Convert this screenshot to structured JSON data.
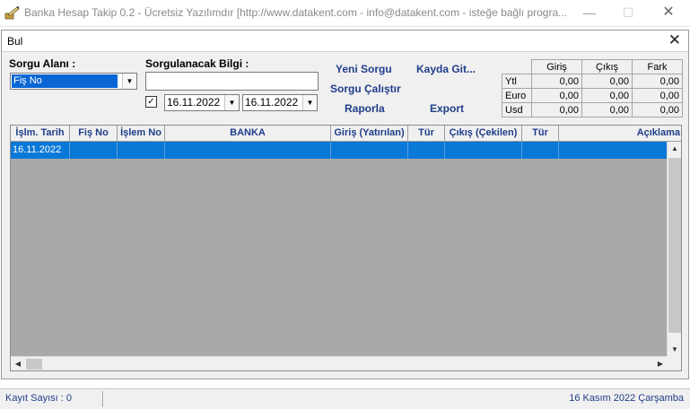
{
  "window": {
    "title": "Banka Hesap Takip 0.2 - Ücretsiz Yazılımdır [http://www.datakent.com - info@datakent.com - isteğe bağlı progra...",
    "minimize": "—",
    "maximize": "☐",
    "close": "✕"
  },
  "dialog": {
    "title": "Bul",
    "close": "✕"
  },
  "query": {
    "field_label": "Sorgu Alanı :",
    "field_value": "Fiş No",
    "info_label": "Sorgulanacak Bilgi :",
    "info_value": "",
    "date_check": "✓",
    "date_from": "16.11.2022",
    "date_to": "16.11.2022"
  },
  "actions": {
    "new_query": "Yeni Sorgu",
    "run_query": "Sorgu Çalıştır",
    "report": "Raporla",
    "goto_record": "Kayda Git...",
    "export": "Export"
  },
  "currency_table": {
    "headers": [
      "Giriş",
      "Çıkış",
      "Fark"
    ],
    "rows": [
      {
        "name": "Ytl",
        "values": [
          "0,00",
          "0,00",
          "0,00"
        ]
      },
      {
        "name": "Euro",
        "values": [
          "0,00",
          "0,00",
          "0,00"
        ]
      },
      {
        "name": "Usd",
        "values": [
          "0,00",
          "0,00",
          "0,00"
        ]
      }
    ]
  },
  "grid": {
    "columns": [
      "İşlm. Tarih",
      "Fiş No",
      "İşlem No",
      "BANKA",
      "Giriş (Yatırılan)",
      "Tür",
      "Çıkış (Çekilen)",
      "Tür",
      "Açıklama"
    ],
    "rows": [
      [
        "16.11.2022",
        "",
        "",
        "",
        "",
        "",
        "",
        "",
        ""
      ]
    ]
  },
  "status": {
    "record_count": "Kayıt Sayısı : 0",
    "date": "16 Kasım 2022 Çarşamba"
  },
  "colors": {
    "accent": "#1f3d8a",
    "selection": "#0a78d7"
  }
}
